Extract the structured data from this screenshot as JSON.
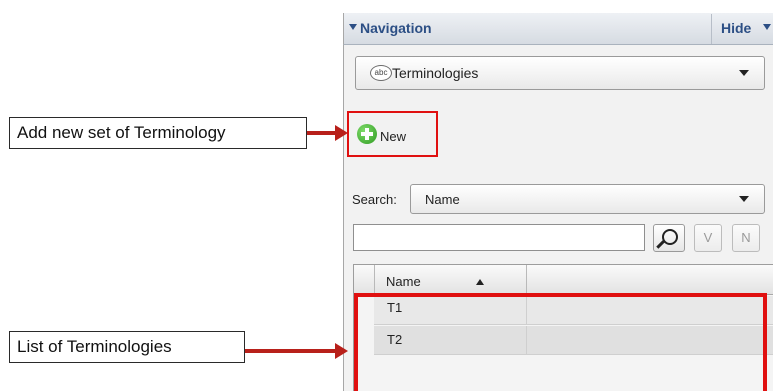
{
  "navigation": {
    "title": "Navigation",
    "hide_label": "Hide",
    "module_selector": {
      "label": "Terminologies",
      "icon": "abc-icon"
    },
    "new_button": {
      "label": "New",
      "icon": "plus-circle-icon"
    },
    "search": {
      "label": "Search:",
      "field_option": "Name",
      "input_value": "",
      "v_button": "V",
      "n_button": "N"
    },
    "table": {
      "columns": [
        "Name",
        ""
      ],
      "sort_column": "Name",
      "rows": [
        {
          "name": "T1"
        },
        {
          "name": "T2"
        }
      ]
    }
  },
  "annotations": {
    "new_callout": "Add new set of Terminology",
    "list_callout": "List of Terminologies"
  },
  "colors": {
    "highlight": "#e01010",
    "arrow": "#b8201a",
    "header_text": "#2c4f85",
    "new_icon": "#3aa62b"
  }
}
